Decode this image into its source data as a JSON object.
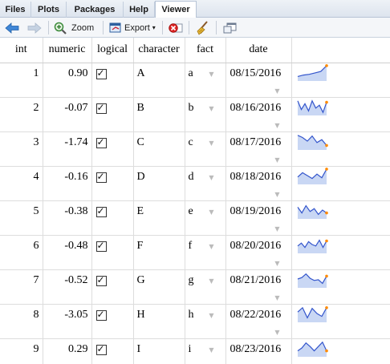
{
  "tabs": [
    {
      "label": "Files",
      "active": false
    },
    {
      "label": "Plots",
      "active": false
    },
    {
      "label": "Packages",
      "active": false
    },
    {
      "label": "Help",
      "active": false
    },
    {
      "label": "Viewer",
      "active": true
    }
  ],
  "toolbar": {
    "zoom_label": "Zoom",
    "export_label": "Export",
    "icons": [
      "back-arrow-icon",
      "forward-arrow-icon",
      "zoom-icon",
      "export-icon",
      "clear-icon",
      "broom-icon",
      "popout-icon"
    ]
  },
  "colors": {
    "spark_line": "#3355cc",
    "spark_fill": "#c9d7f4",
    "spark_end": "#ff8a00"
  },
  "table": {
    "headers": [
      "int",
      "numeric",
      "logical",
      "character",
      "fact",
      "date"
    ],
    "rows": [
      {
        "int": "1",
        "numeric": "0.90",
        "logical": true,
        "character": "A",
        "fact": "a",
        "date": "08/15/2016",
        "spark": [
          0.2,
          0.3,
          0.35,
          0.45,
          0.55,
          0.95
        ]
      },
      {
        "int": "2",
        "numeric": "-0.07",
        "logical": true,
        "character": "B",
        "fact": "b",
        "date": "08/16/2016",
        "spark": [
          0.9,
          0.3,
          0.7,
          0.2,
          0.9,
          0.4,
          0.6,
          0.1,
          0.8
        ]
      },
      {
        "int": "3",
        "numeric": "-1.74",
        "logical": true,
        "character": "C",
        "fact": "c",
        "date": "08/17/2016",
        "spark": [
          0.9,
          0.75,
          0.5,
          0.85,
          0.4,
          0.6,
          0.2
        ]
      },
      {
        "int": "4",
        "numeric": "-0.16",
        "logical": true,
        "character": "D",
        "fact": "d",
        "date": "08/18/2016",
        "spark": [
          0.4,
          0.7,
          0.5,
          0.3,
          0.6,
          0.35,
          0.95
        ]
      },
      {
        "int": "5",
        "numeric": "-0.38",
        "logical": true,
        "character": "E",
        "fact": "e",
        "date": "08/19/2016",
        "spark": [
          0.7,
          0.3,
          0.8,
          0.4,
          0.6,
          0.2,
          0.5,
          0.3
        ]
      },
      {
        "int": "6",
        "numeric": "-0.48",
        "logical": true,
        "character": "F",
        "fact": "f",
        "date": "08/20/2016",
        "spark": [
          0.4,
          0.6,
          0.3,
          0.7,
          0.5,
          0.4,
          0.8,
          0.3,
          0.75
        ]
      },
      {
        "int": "7",
        "numeric": "-0.52",
        "logical": true,
        "character": "G",
        "fact": "g",
        "date": "08/21/2016",
        "spark": [
          0.5,
          0.6,
          0.85,
          0.55,
          0.4,
          0.45,
          0.2,
          0.7
        ]
      },
      {
        "int": "8",
        "numeric": "-3.05",
        "logical": true,
        "character": "H",
        "fact": "h",
        "date": "08/22/2016",
        "spark": [
          0.6,
          0.9,
          0.2,
          0.85,
          0.5,
          0.3,
          0.9
        ]
      },
      {
        "int": "9",
        "numeric": "0.29",
        "logical": true,
        "character": "I",
        "fact": "i",
        "date": "08/23/2016",
        "spark": [
          0.3,
          0.5,
          0.85,
          0.6,
          0.3,
          0.6,
          0.9,
          0.3
        ]
      }
    ]
  }
}
